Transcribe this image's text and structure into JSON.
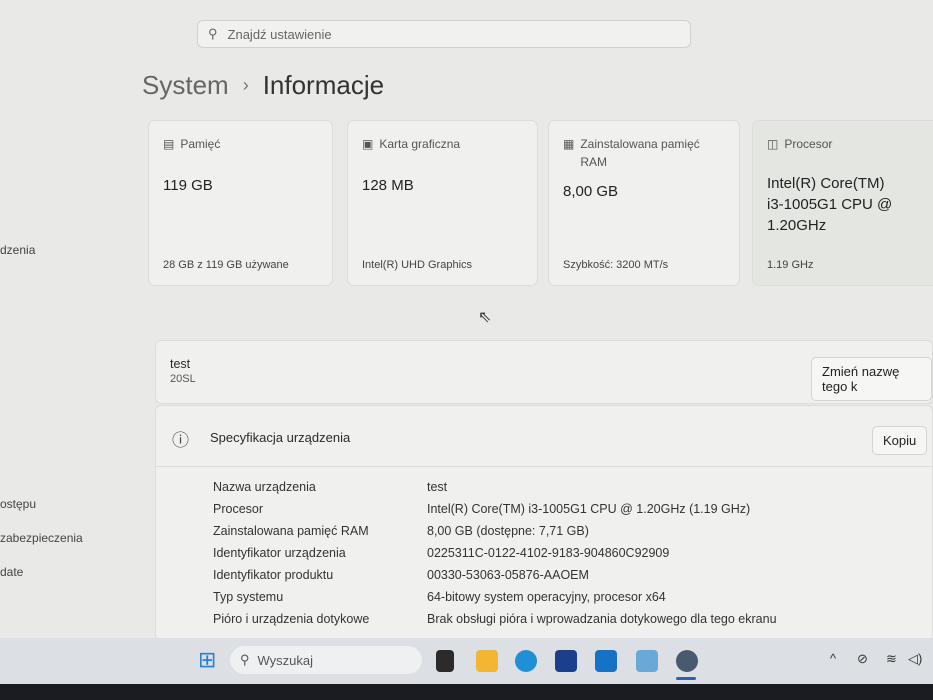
{
  "search": {
    "placeholder": "Znajdź ustawienie"
  },
  "breadcrumb": {
    "parent": "System",
    "separator": "›",
    "current": "Informacje"
  },
  "sidebar": {
    "items": [
      "dzenia",
      "ostępu",
      "zabezpieczenia",
      "date"
    ]
  },
  "cards": [
    {
      "title": "Pamięć",
      "value": "119 GB",
      "sub": "28 GB z 119 GB używane",
      "icon": "storage-icon"
    },
    {
      "title": "Karta graficzna",
      "value": "128 MB",
      "sub": "Intel(R) UHD Graphics",
      "icon": "gpu-icon"
    },
    {
      "title": "Zainstalowana pamięć RAM",
      "value": "8,00 GB",
      "sub": "Szybkość: 3200 MT/s",
      "icon": "ram-icon"
    },
    {
      "title": "Procesor",
      "value": "Intel(R) Core(TM) i3-1005G1 CPU @ 1.20GHz",
      "sub": "1.19 GHz",
      "icon": "cpu-icon"
    }
  ],
  "device": {
    "name": "test",
    "model": "20SL",
    "rename_label": "Zmień nazwę tego k"
  },
  "spec": {
    "title": "Specyfikacja urządzenia",
    "copy_label": "Kopiu",
    "rows": [
      {
        "k": "Nazwa urządzenia",
        "v": "test"
      },
      {
        "k": "Procesor",
        "v": "Intel(R) Core(TM) i3-1005G1 CPU @ 1.20GHz (1.19 GHz)"
      },
      {
        "k": "Zainstalowana pamięć RAM",
        "v": "8,00 GB (dostępne: 7,71 GB)"
      },
      {
        "k": "Identyfikator urządzenia",
        "v": "0225311C-0122-4102-9183-904860C92909"
      },
      {
        "k": "Identyfikator produktu",
        "v": "00330-53063-05876-AAOEM"
      },
      {
        "k": "Typ systemu",
        "v": "64-bitowy system operacyjny, procesor x64"
      },
      {
        "k": "Pióro i urządzenia dotykowe",
        "v": "Brak obsługi pióra i wprowadzania dotykowego dla tego ekranu"
      }
    ]
  },
  "taskbar": {
    "search_placeholder": "Wyszukaj"
  }
}
